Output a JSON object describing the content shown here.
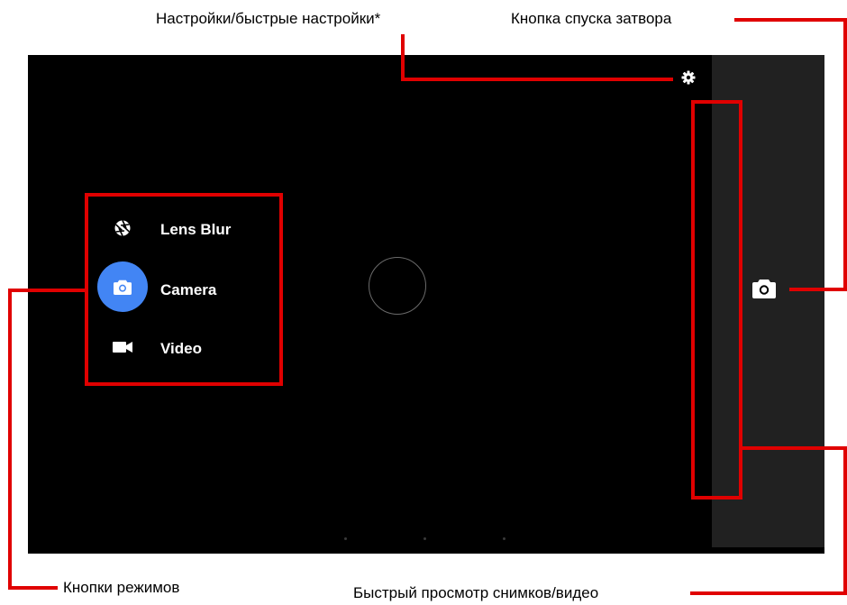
{
  "callouts": {
    "settings": "Настройки/быстрые настройки*",
    "shutter": "Кнопка спуска затвора",
    "modes": "Кнопки режимов",
    "preview": "Быстрый просмотр снимков/видео"
  },
  "modes": [
    {
      "label": "Lens Blur",
      "icon": "aperture-icon",
      "selected": false
    },
    {
      "label": "Camera",
      "icon": "camera-icon",
      "selected": true
    },
    {
      "label": "Video",
      "icon": "video-camera-icon",
      "selected": false
    }
  ],
  "icons": {
    "settings": "gear-icon",
    "shutter": "camera-icon"
  },
  "colors": {
    "annotation": "#e00000",
    "selected_mode": "#4285f4",
    "screen_background": "#000000",
    "side_panel": "#212121"
  }
}
